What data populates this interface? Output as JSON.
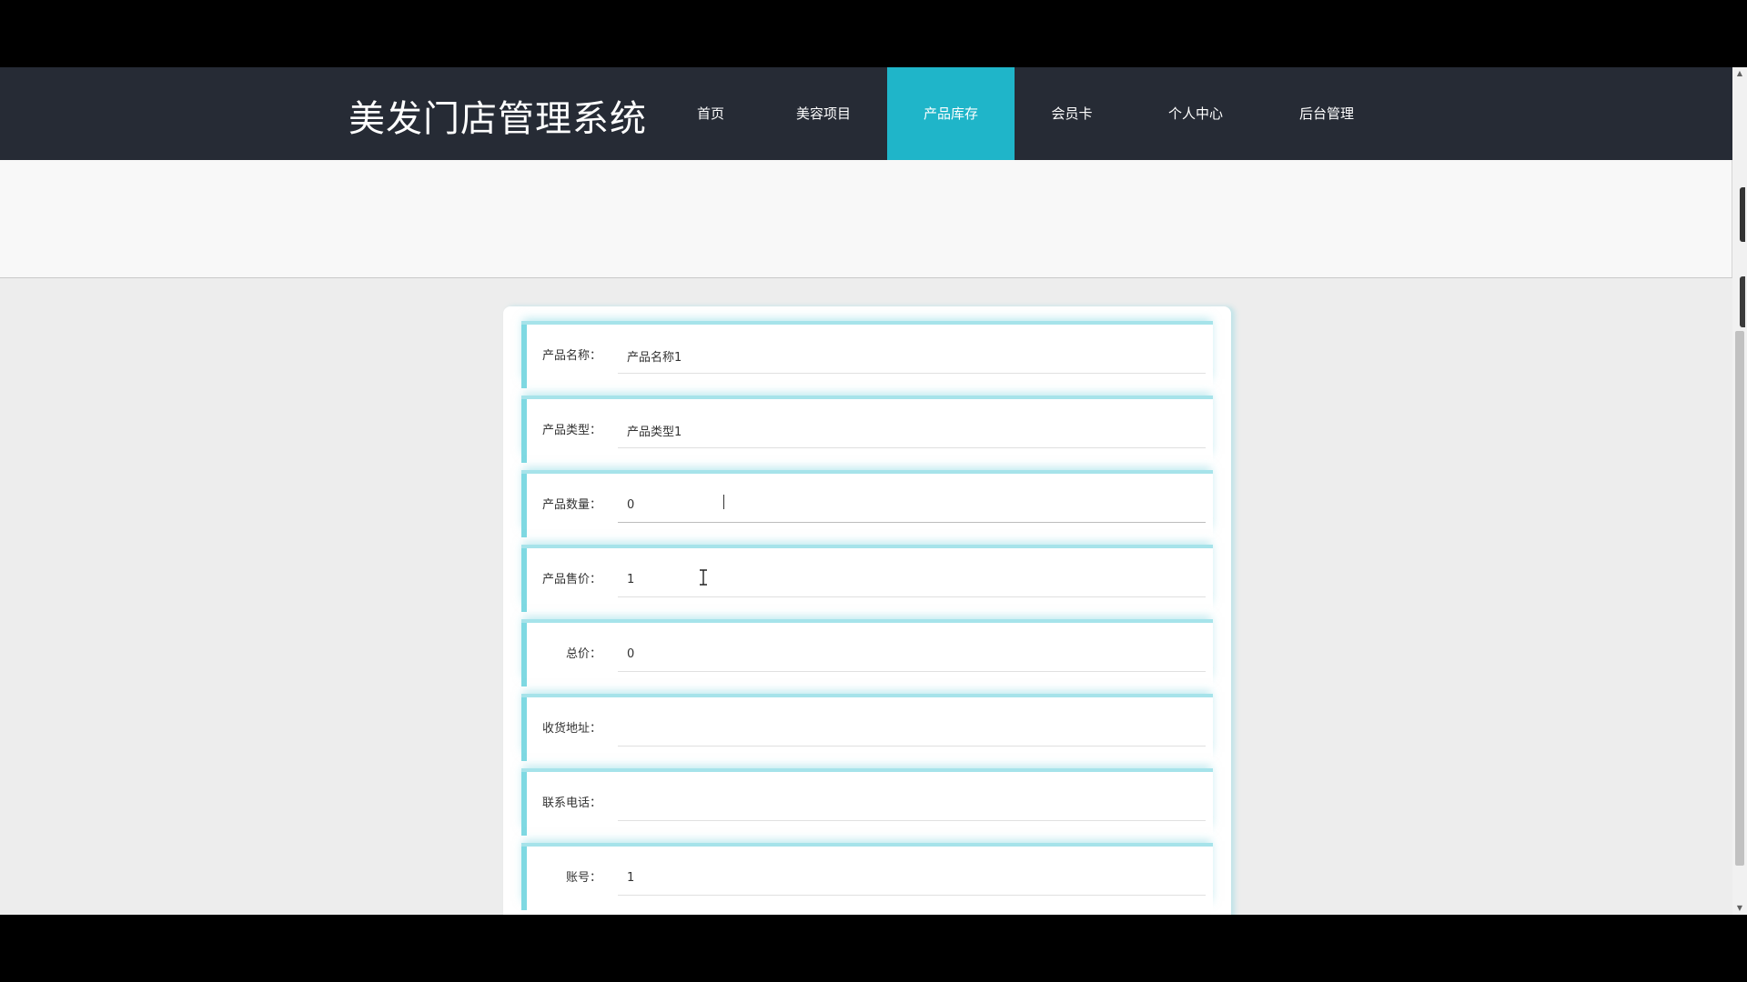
{
  "header": {
    "brand": "美发门店管理系统",
    "nav": [
      {
        "label": "首页",
        "active": false
      },
      {
        "label": "美容项目",
        "active": false
      },
      {
        "label": "产品库存",
        "active": true
      },
      {
        "label": "会员卡",
        "active": false
      },
      {
        "label": "个人中心",
        "active": false
      },
      {
        "label": "后台管理",
        "active": false
      }
    ]
  },
  "form": {
    "fields": [
      {
        "label": "产品名称：",
        "value": "产品名称1"
      },
      {
        "label": "产品类型：",
        "value": "产品类型1"
      },
      {
        "label": "产品数量：",
        "value": "0"
      },
      {
        "label": "产品售价：",
        "value": "1"
      },
      {
        "label": "总价：",
        "value": "0"
      },
      {
        "label": "收货地址：",
        "value": ""
      },
      {
        "label": "联系电话：",
        "value": ""
      },
      {
        "label": "账号：",
        "value": "1"
      }
    ]
  },
  "colors": {
    "nav_bg": "#262b35",
    "nav_active": "#1fb5c9",
    "row_accent": "#7fd9e2"
  }
}
